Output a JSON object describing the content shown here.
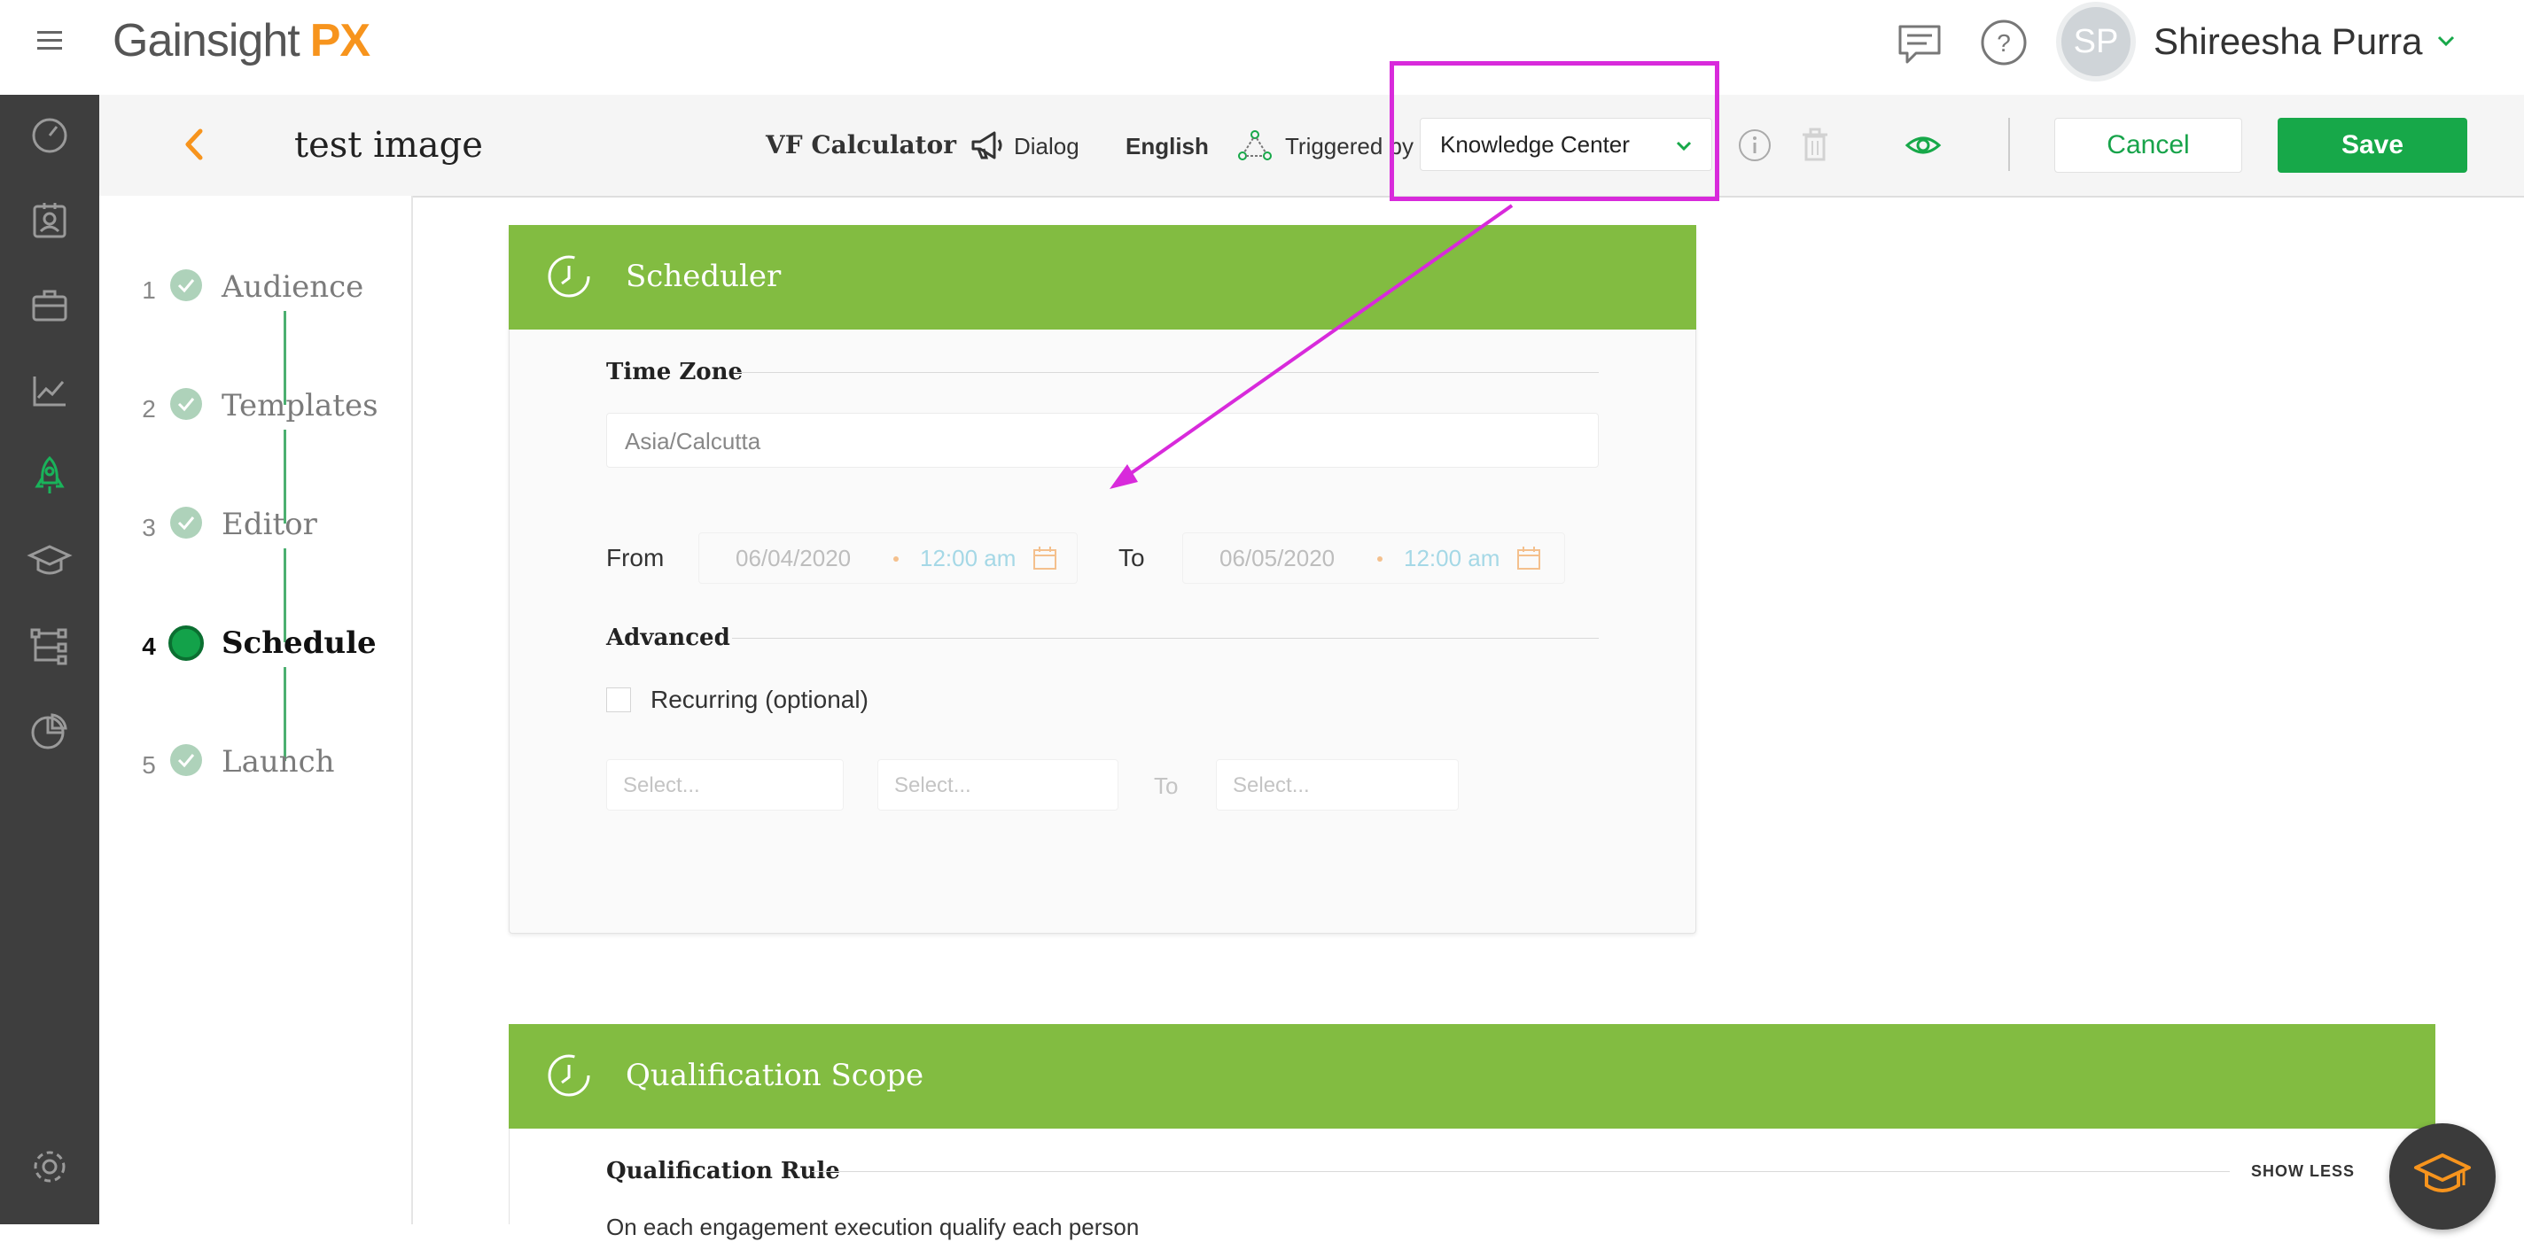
{
  "header": {
    "logo_text": "Gainsight",
    "logo_accent": "PX",
    "user_initials": "SP",
    "user_name": "Shireesha Purra"
  },
  "subheader": {
    "title": "test image",
    "engagement_name": "VF Calculator",
    "type_label": "Dialog",
    "language": "English",
    "triggered_by_label": "Triggered by",
    "trigger_value": "Knowledge Center",
    "cancel_label": "Cancel",
    "save_label": "Save"
  },
  "steps": [
    {
      "num": "1",
      "label": "Audience",
      "state": "done"
    },
    {
      "num": "2",
      "label": "Templates",
      "state": "done"
    },
    {
      "num": "3",
      "label": "Editor",
      "state": "done"
    },
    {
      "num": "4",
      "label": "Schedule",
      "state": "current"
    },
    {
      "num": "5",
      "label": "Launch",
      "state": "done"
    }
  ],
  "scheduler": {
    "title": "Scheduler",
    "timezone_label": "Time Zone",
    "timezone_value": "Asia/Calcutta",
    "from_label": "From",
    "from_date": "06/04/2020",
    "from_time": "12:00 am",
    "to_label": "To",
    "to_date": "06/05/2020",
    "to_time": "12:00 am",
    "advanced_label": "Advanced",
    "recurring_label": "Recurring (optional)",
    "select_placeholder_1": "Select...",
    "select_placeholder_2": "Select...",
    "range_to_label": "To",
    "select_placeholder_3": "Select..."
  },
  "qualification": {
    "title": "Qualification Scope",
    "rule_label": "Qualification Rule",
    "show_less_label": "SHOW LESS",
    "description": "On each engagement execution qualify each person"
  },
  "colors": {
    "accent_green": "#17a849",
    "card_header_green": "#82bc41",
    "logo_orange": "#f7941d",
    "rail_bg": "#3e3e3e",
    "annotation_magenta": "#d82adb"
  },
  "icons": {
    "rail": [
      "speedometer-icon",
      "contacts-icon",
      "briefcase-icon",
      "analytics-icon",
      "rocket-icon",
      "graduation-cap-icon",
      "hierarchy-icon",
      "pie-chart-icon",
      "settings-icon"
    ]
  }
}
